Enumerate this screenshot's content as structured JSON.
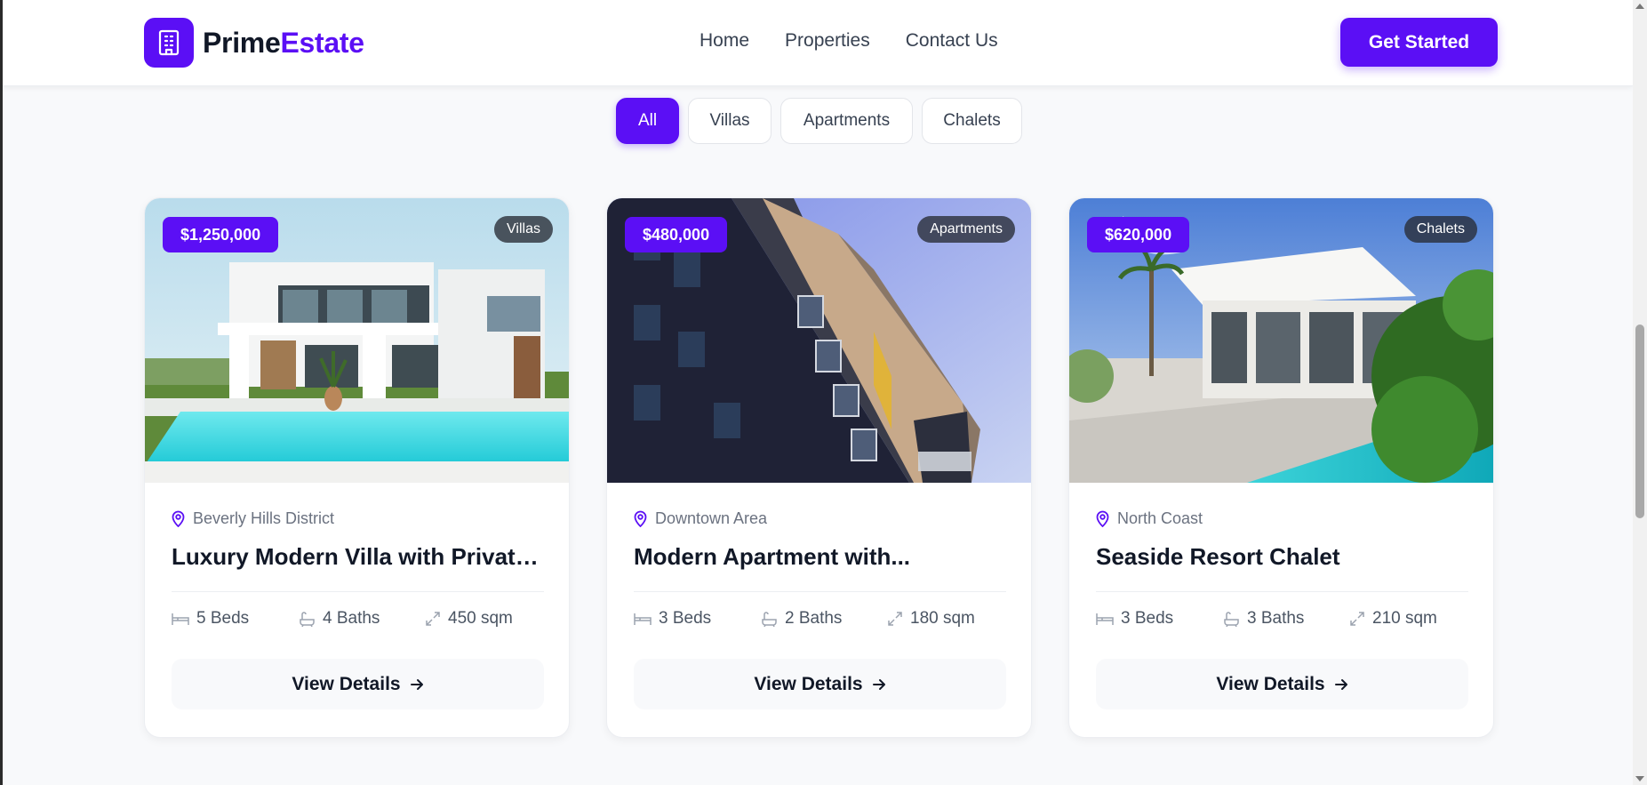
{
  "brand": {
    "name_part1": "Prime",
    "name_part2": "Estate",
    "icon": "building-icon",
    "color": "#5b0ff5"
  },
  "nav": {
    "items": [
      {
        "label": "Home"
      },
      {
        "label": "Properties"
      },
      {
        "label": "Contact Us"
      }
    ],
    "cta_label": "Get Started"
  },
  "filters": [
    {
      "label": "All",
      "active": true
    },
    {
      "label": "Villas",
      "active": false
    },
    {
      "label": "Apartments",
      "active": false
    },
    {
      "label": "Chalets",
      "active": false
    }
  ],
  "properties": [
    {
      "price": "$1,250,000",
      "category": "Villas",
      "location": "Beverly Hills District",
      "title": "Luxury Modern Villa with Private Pool",
      "beds": "5 Beds",
      "baths": "4 Baths",
      "area": "450 sqm",
      "details_label": "View Details"
    },
    {
      "price": "$480,000",
      "category": "Apartments",
      "location": "Downtown Area",
      "title": "Modern Apartment with...",
      "beds": "3 Beds",
      "baths": "2 Baths",
      "area": "180 sqm",
      "details_label": "View Details"
    },
    {
      "price": "$620,000",
      "category": "Chalets",
      "location": "North Coast",
      "title": "Seaside Resort Chalet",
      "beds": "3 Beds",
      "baths": "3 Baths",
      "area": "210 sqm",
      "details_label": "View Details"
    }
  ]
}
